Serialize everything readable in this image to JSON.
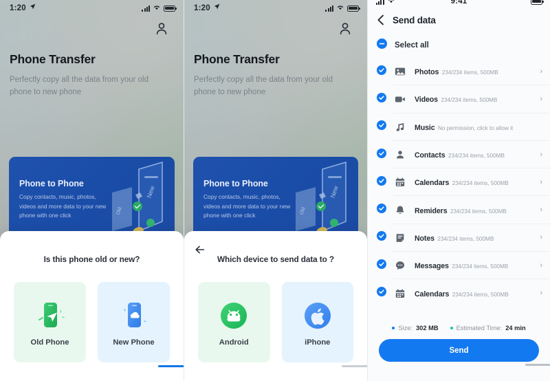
{
  "panel1": {
    "statusbar": {
      "time": "1:20",
      "location_icon": "location-arrow-icon",
      "signal_icon": "signal-bars-icon",
      "wifi_icon": "wifi-icon",
      "battery_icon": "battery-full-icon"
    },
    "account_icon": "person-icon",
    "hero": {
      "title": "Phone Transfer",
      "subtitle": "Perfectly copy all the data from your old phone to new phone"
    },
    "promo": {
      "title": "Phone to Phone",
      "body": "Copy contacts, music, photos, videos and more data to your new phone with one click",
      "art_label_old": "Old",
      "art_label_new": "New"
    },
    "sheet": {
      "question": "Is this phone old or new?",
      "choices": [
        {
          "label": "Old Phone",
          "icon": "phone-send-icon",
          "accent": "#22b157",
          "tile": "#e9f8ee"
        },
        {
          "label": "New Phone",
          "icon": "phone-cloud-icon",
          "accent": "#3f8df5",
          "tile": "#e4f3fd"
        }
      ]
    }
  },
  "panel2": {
    "statusbar": {
      "time": "1:20",
      "location_icon": "location-arrow-icon",
      "signal_icon": "signal-bars-icon",
      "wifi_icon": "wifi-icon",
      "battery_icon": "battery-full-icon"
    },
    "account_icon": "person-icon",
    "hero": {
      "title": "Phone Transfer",
      "subtitle": "Perfectly copy all the data from your old phone to new phone"
    },
    "promo": {
      "title": "Phone to Phone",
      "body": "Copy contacts, music, photos, videos and more data to your new phone with one click"
    },
    "sheet": {
      "back_icon": "arrow-left-icon",
      "question": "Which device to send data to ?",
      "choices": [
        {
          "label": "Android",
          "icon": "android-icon",
          "accent": "#1fc25c",
          "tile": "#e9f8ee"
        },
        {
          "label": "iPhone",
          "icon": "apple-icon",
          "accent": "#3f8df5",
          "tile": "#e4f3fd"
        }
      ]
    }
  },
  "panel3": {
    "statusbar": {
      "time": "9:41",
      "signal_icon": "signal-bars-icon",
      "wifi_icon": "wifi-icon",
      "battery_icon": "battery-full-icon"
    },
    "nav": {
      "back_icon": "chevron-left-icon",
      "title": "Send data"
    },
    "select_all": {
      "label": "Select all",
      "state": "indeterminate",
      "icon": "minus-circle-icon"
    },
    "accent_color": "#1379f0",
    "rows": [
      {
        "title": "Photos",
        "subtitle": "234/234 items, 500MB",
        "icon": "image-icon",
        "checked": true,
        "chevron": true
      },
      {
        "title": "Videos",
        "subtitle": "234/234 items, 500MB",
        "icon": "video-icon",
        "checked": true,
        "chevron": true
      },
      {
        "title": "Music",
        "subtitle": "No permission,  click to allow it",
        "icon": "music-icon",
        "checked": true,
        "chevron": false
      },
      {
        "title": "Contacts",
        "subtitle": "234/234 items, 500MB",
        "icon": "contact-icon",
        "checked": true,
        "chevron": true
      },
      {
        "title": "Calendars",
        "subtitle": "234/234 items, 500MB",
        "icon": "calendar-icon",
        "checked": true,
        "chevron": true
      },
      {
        "title": "Remiders",
        "subtitle": "234/234 items, 500MB",
        "icon": "bell-icon",
        "checked": true,
        "chevron": true
      },
      {
        "title": "Notes",
        "subtitle": "234/234 items, 500MB",
        "icon": "notes-icon",
        "checked": true,
        "chevron": true
      },
      {
        "title": "Messages",
        "subtitle": "234/234 items, 500MB",
        "icon": "message-icon",
        "checked": true,
        "chevron": true
      },
      {
        "title": "Calendars",
        "subtitle": "234/234 items, 500MB",
        "icon": "calendar-icon",
        "checked": true,
        "chevron": true
      }
    ],
    "summary": {
      "size_label": "Size:",
      "size_value": "302 MB",
      "size_dot_color": "#1379f0",
      "time_label": "Estimated Time:",
      "time_value": "24 min",
      "time_dot_color": "#17c2a3"
    },
    "send_button": "Send",
    "chevron_glyph": "›"
  }
}
